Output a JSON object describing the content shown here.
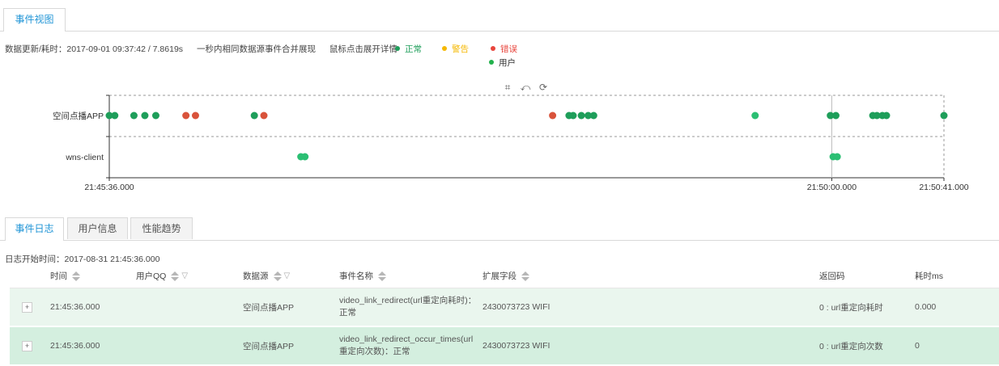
{
  "top_tabs": [
    {
      "label": "事件视图"
    }
  ],
  "info": {
    "update_label": "数据更新/耗时：2017-09-01 09:37:42 / 7.8619s",
    "merge_note": "一秒内相同数据源事件合并展现",
    "click_hint": "鼠标点击展开详情"
  },
  "legend": [
    {
      "label": "正常",
      "color": "#1e9e5a"
    },
    {
      "label": "警告",
      "color": "#f5b800"
    },
    {
      "label": "错误",
      "color": "#e8453c"
    },
    {
      "label": "用户",
      "color": "#22b14c"
    }
  ],
  "chart_tools": {
    "crop": "crop-icon",
    "crop_reset": "crop-reset-icon",
    "refresh": "refresh-icon"
  },
  "chart_data": {
    "type": "scatter",
    "rows": [
      "空间点播APP",
      "wns-client"
    ],
    "x_ticks": [
      "21:45:36.000",
      "21:50:00.000",
      "21:50:41.000"
    ],
    "x_range": [
      "21:45:36.000",
      "21:50:41.000"
    ],
    "colors": {
      "normal": "#1e9e5a",
      "normal_light": "#2bbf73",
      "error": "#d9533b"
    },
    "series": [
      {
        "row": "空间点播APP",
        "points": [
          {
            "t": "21:45:36.000",
            "s": "normal"
          },
          {
            "t": "21:45:38.000",
            "s": "normal"
          },
          {
            "t": "21:45:45.000",
            "s": "normal"
          },
          {
            "t": "21:45:49.000",
            "s": "normal"
          },
          {
            "t": "21:45:53.000",
            "s": "normal"
          },
          {
            "t": "21:46:04.000",
            "s": "error"
          },
          {
            "t": "21:46:07.500",
            "s": "error"
          },
          {
            "t": "21:46:29.000",
            "s": "normal"
          },
          {
            "t": "21:46:32.500",
            "s": "error"
          },
          {
            "t": "21:48:18.000",
            "s": "error"
          },
          {
            "t": "21:48:24.000",
            "s": "normal"
          },
          {
            "t": "21:48:25.500",
            "s": "normal"
          },
          {
            "t": "21:48:28.500",
            "s": "normal"
          },
          {
            "t": "21:48:31.000",
            "s": "normal"
          },
          {
            "t": "21:48:33.000",
            "s": "normal"
          },
          {
            "t": "21:49:32.000",
            "s": "normal_light"
          },
          {
            "t": "21:49:59.500",
            "s": "normal"
          },
          {
            "t": "21:50:01.500",
            "s": "normal"
          },
          {
            "t": "21:50:15.000",
            "s": "normal"
          },
          {
            "t": "21:50:16.500",
            "s": "normal"
          },
          {
            "t": "21:50:18.500",
            "s": "normal"
          },
          {
            "t": "21:50:20.000",
            "s": "normal"
          },
          {
            "t": "21:50:41.000",
            "s": "normal"
          }
        ]
      },
      {
        "row": "wns-client",
        "points": [
          {
            "t": "21:46:46.000",
            "s": "normal_light"
          },
          {
            "t": "21:46:47.500",
            "s": "normal_light"
          },
          {
            "t": "21:50:00.500",
            "s": "normal_light"
          },
          {
            "t": "21:50:02.000",
            "s": "normal_light"
          }
        ]
      }
    ]
  },
  "bottom_tabs": [
    {
      "label": "事件日志"
    },
    {
      "label": "用户信息"
    },
    {
      "label": "性能趋势"
    }
  ],
  "log": {
    "start_label": "日志开始时间：2017-08-31 21:45:36.000",
    "columns": [
      "时间",
      "用户QQ",
      "数据源",
      "事件名称",
      "扩展字段",
      "返回码",
      "耗时ms"
    ],
    "rows": [
      {
        "time": "21:45:36.000",
        "qq": "",
        "source": "空间点播APP",
        "event": "video_link_redirect(url重定向耗时)：正常",
        "ext": "2430073723 WIFI",
        "code": "0 : url重定向耗时",
        "cost": "0.000"
      },
      {
        "time": "21:45:36.000",
        "qq": "",
        "source": "空间点播APP",
        "event": "video_link_redirect_occur_times(url重定向次数)：正常",
        "ext": "2430073723 WIFI",
        "code": "0 : url重定向次数",
        "cost": "0"
      }
    ]
  }
}
